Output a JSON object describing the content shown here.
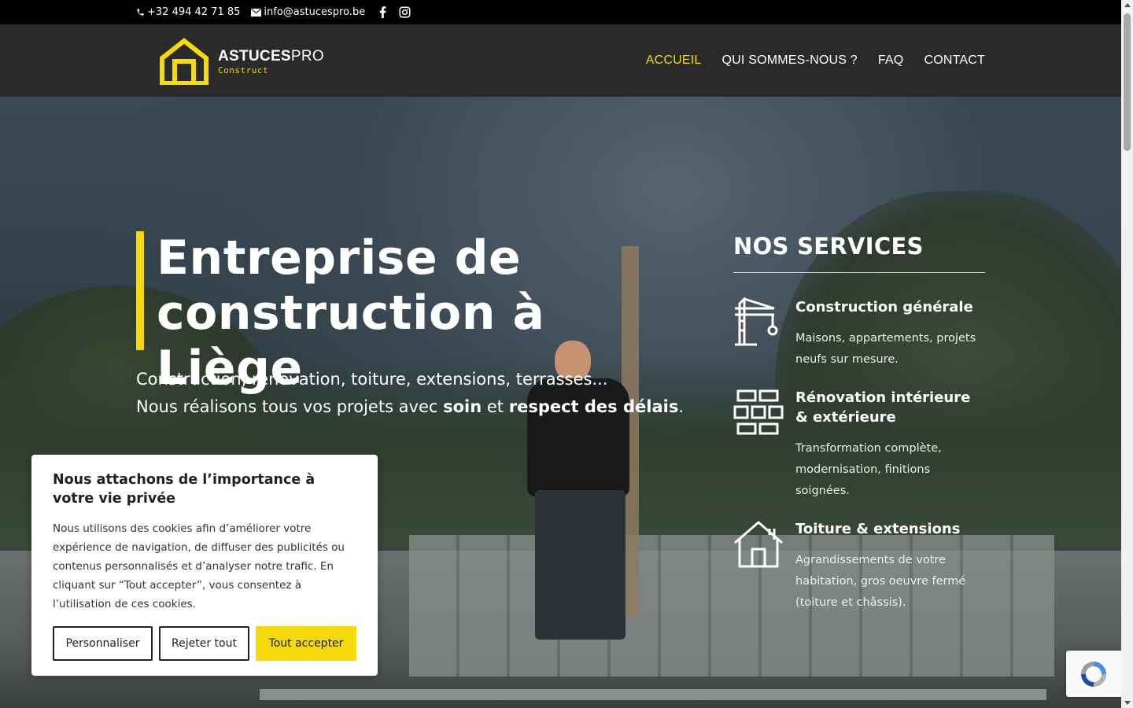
{
  "topbar": {
    "phone": "+32 494 42 71 85",
    "email": "info@astucespro.be"
  },
  "logo": {
    "brand_bold": "ASTUCES",
    "brand_light": "PRO",
    "sub": "Construct"
  },
  "nav": {
    "items": [
      {
        "label": "ACCUEIL"
      },
      {
        "label": "QUI SOMMES-NOUS ?"
      },
      {
        "label": "FAQ"
      },
      {
        "label": "CONTACT"
      }
    ]
  },
  "hero": {
    "title_line1": "Entreprise de",
    "title_line2": "construction à Liège",
    "sub_line1": "Construction, rénovation, toiture, extensions, terrasses...",
    "sub_line2_a": "Nous réalisons tous vos projets avec ",
    "sub_line2_b": "soin",
    "sub_line2_c": " et ",
    "sub_line2_d": "respect des délais",
    "sub_line2_e": "."
  },
  "services": {
    "heading": "NOS SERVICES",
    "items": [
      {
        "title": "Construction générale",
        "desc": "Maisons, appartements, projets neufs sur mesure."
      },
      {
        "title": "Rénovation intérieure & extérieure",
        "desc": "Transformation complète, modernisation, finitions soignées."
      },
      {
        "title": "Toiture & extensions",
        "desc": "Agrandissements de votre habitation, gros oeuvre fermé (toiture et châssis)."
      }
    ]
  },
  "cookie": {
    "title": "Nous attachons de l’importance à votre vie privée",
    "text": "Nous utilisons des cookies afin d’améliorer votre expérience de navigation, de diffuser des publicités ou contenus personnalisés et d’analyser notre trafic. En cliquant sur “Tout accepter”, vous consentez à l’utilisation de ces cookies.",
    "btn_customize": "Personnaliser",
    "btn_reject": "Rejeter tout",
    "btn_accept": "Tout accepter"
  },
  "colors": {
    "accent": "#f5d90a",
    "header_bg": "#2a2a2a",
    "topbar_bg": "#000000"
  },
  "icons": [
    "phone-icon",
    "mail-icon",
    "facebook-icon",
    "instagram-icon",
    "crane-icon",
    "bricks-icon",
    "house-icon",
    "recaptcha-icon"
  ]
}
